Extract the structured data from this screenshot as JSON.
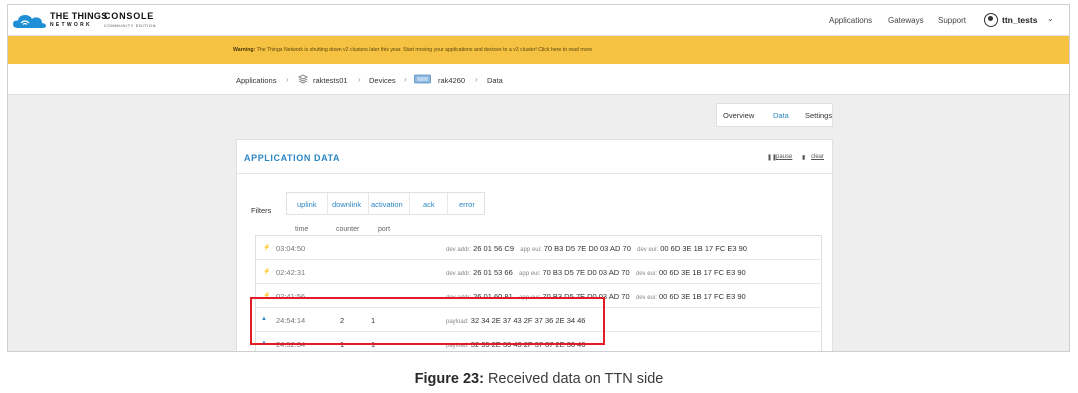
{
  "brand": {
    "line1": "THE THINGS",
    "line2": "NETWORK",
    "line3": "CONSOLE",
    "line4": "COMMUNITY EDITION"
  },
  "nav": {
    "applications": "Applications",
    "gateways": "Gateways",
    "support": "Support",
    "user": "ttn_tests"
  },
  "warning": {
    "title": "Warning:",
    "text": "The Things Network is shutting down v2 clusters later this year. Start moving your applications and devices to a v3 cluster! Click here to read more"
  },
  "breadcrumb": {
    "items": [
      "Applications",
      "raktests01",
      "Devices",
      "rak4260",
      "Data"
    ]
  },
  "tabs": {
    "overview": "Overview",
    "data": "Data",
    "settings": "Settings"
  },
  "panel": {
    "title": "APPLICATION DATA",
    "pause": "pause",
    "clear": "clear"
  },
  "filters": {
    "label": "Filters",
    "items": [
      "uplink",
      "downlink",
      "activation",
      "ack",
      "error"
    ]
  },
  "columns": {
    "time": "time",
    "counter": "counter",
    "port": "port"
  },
  "rows": [
    {
      "time": "03:04:50",
      "kind": "activation",
      "dev_addr_label": "dev addr:",
      "dev_addr": "26 01 56 C9",
      "app_eui_label": "app eui:",
      "app_eui": "70 B3 D5 7E D0 03 AD 70",
      "dev_eui_label": "dev eui:",
      "dev_eui": "00 6D 3E 1B 17 FC E3 90"
    },
    {
      "time": "02:42:31",
      "kind": "activation",
      "dev_addr_label": "dev addr:",
      "dev_addr": "26 01 53 66",
      "app_eui_label": "app eui:",
      "app_eui": "70 B3 D5 7E D0 03 AD 70",
      "dev_eui_label": "dev eui:",
      "dev_eui": "00 6D 3E 1B 17 FC E3 90"
    },
    {
      "time": "02:41:56",
      "kind": "activation",
      "dev_addr_label": "dev addr:",
      "dev_addr": "26 01 60 81",
      "app_eui_label": "app eui:",
      "app_eui": "70 B3 D5 7E D0 03 AD 70",
      "dev_eui_label": "dev eui:",
      "dev_eui": "00 6D 3E 1B 17 FC E3 90"
    },
    {
      "time": "24:54:14",
      "kind": "uplink",
      "counter": "2",
      "port": "1",
      "payload_label": "payload:",
      "payload": "32 34 2E 37 43 2F 37 36 2E 34 46"
    },
    {
      "time": "24:52:34",
      "kind": "uplink",
      "counter": "1",
      "port": "1",
      "payload_label": "payload:",
      "payload": "32 35 2E 33 43 2F 37 37 2E 36 46"
    }
  ],
  "caption": {
    "bold": "Figure 23:",
    "text": "Received data on TTN side"
  },
  "colors": {
    "accent": "#2d86c3",
    "warning": "#f5c242",
    "highlight": "#e21b24"
  }
}
